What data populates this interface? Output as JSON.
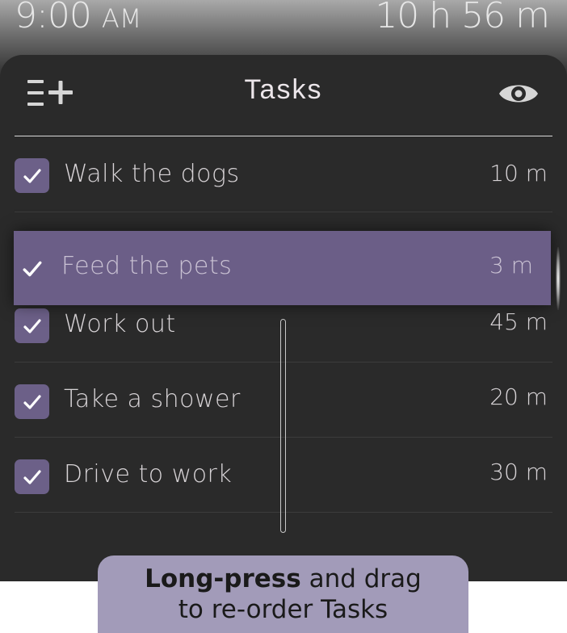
{
  "status_bar": {
    "time": "9:00",
    "ampm": "AM",
    "remaining": "10 h  56 m"
  },
  "header": {
    "title": "Tasks",
    "add_icon": "list-add-icon",
    "visibility_icon": "eye-icon"
  },
  "tasks": [
    {
      "label": "Walk the dogs",
      "duration": "10 m",
      "checked": true
    },
    {
      "label": "Feed the pets",
      "duration": "3 m",
      "checked": true,
      "dragging": true
    },
    {
      "label": "Work out",
      "duration": "45 m",
      "checked": true
    },
    {
      "label": "Take a shower",
      "duration": "20 m",
      "checked": true
    },
    {
      "label": "Drive to work",
      "duration": "30 m",
      "checked": true
    }
  ],
  "hint": {
    "bold": "Long-press",
    "rest_line1": " and drag",
    "line2": "to re-order Tasks"
  },
  "colors": {
    "accent": "#6b5e87",
    "background": "#2a2a2a",
    "hint_bg": "#a29bb9"
  }
}
